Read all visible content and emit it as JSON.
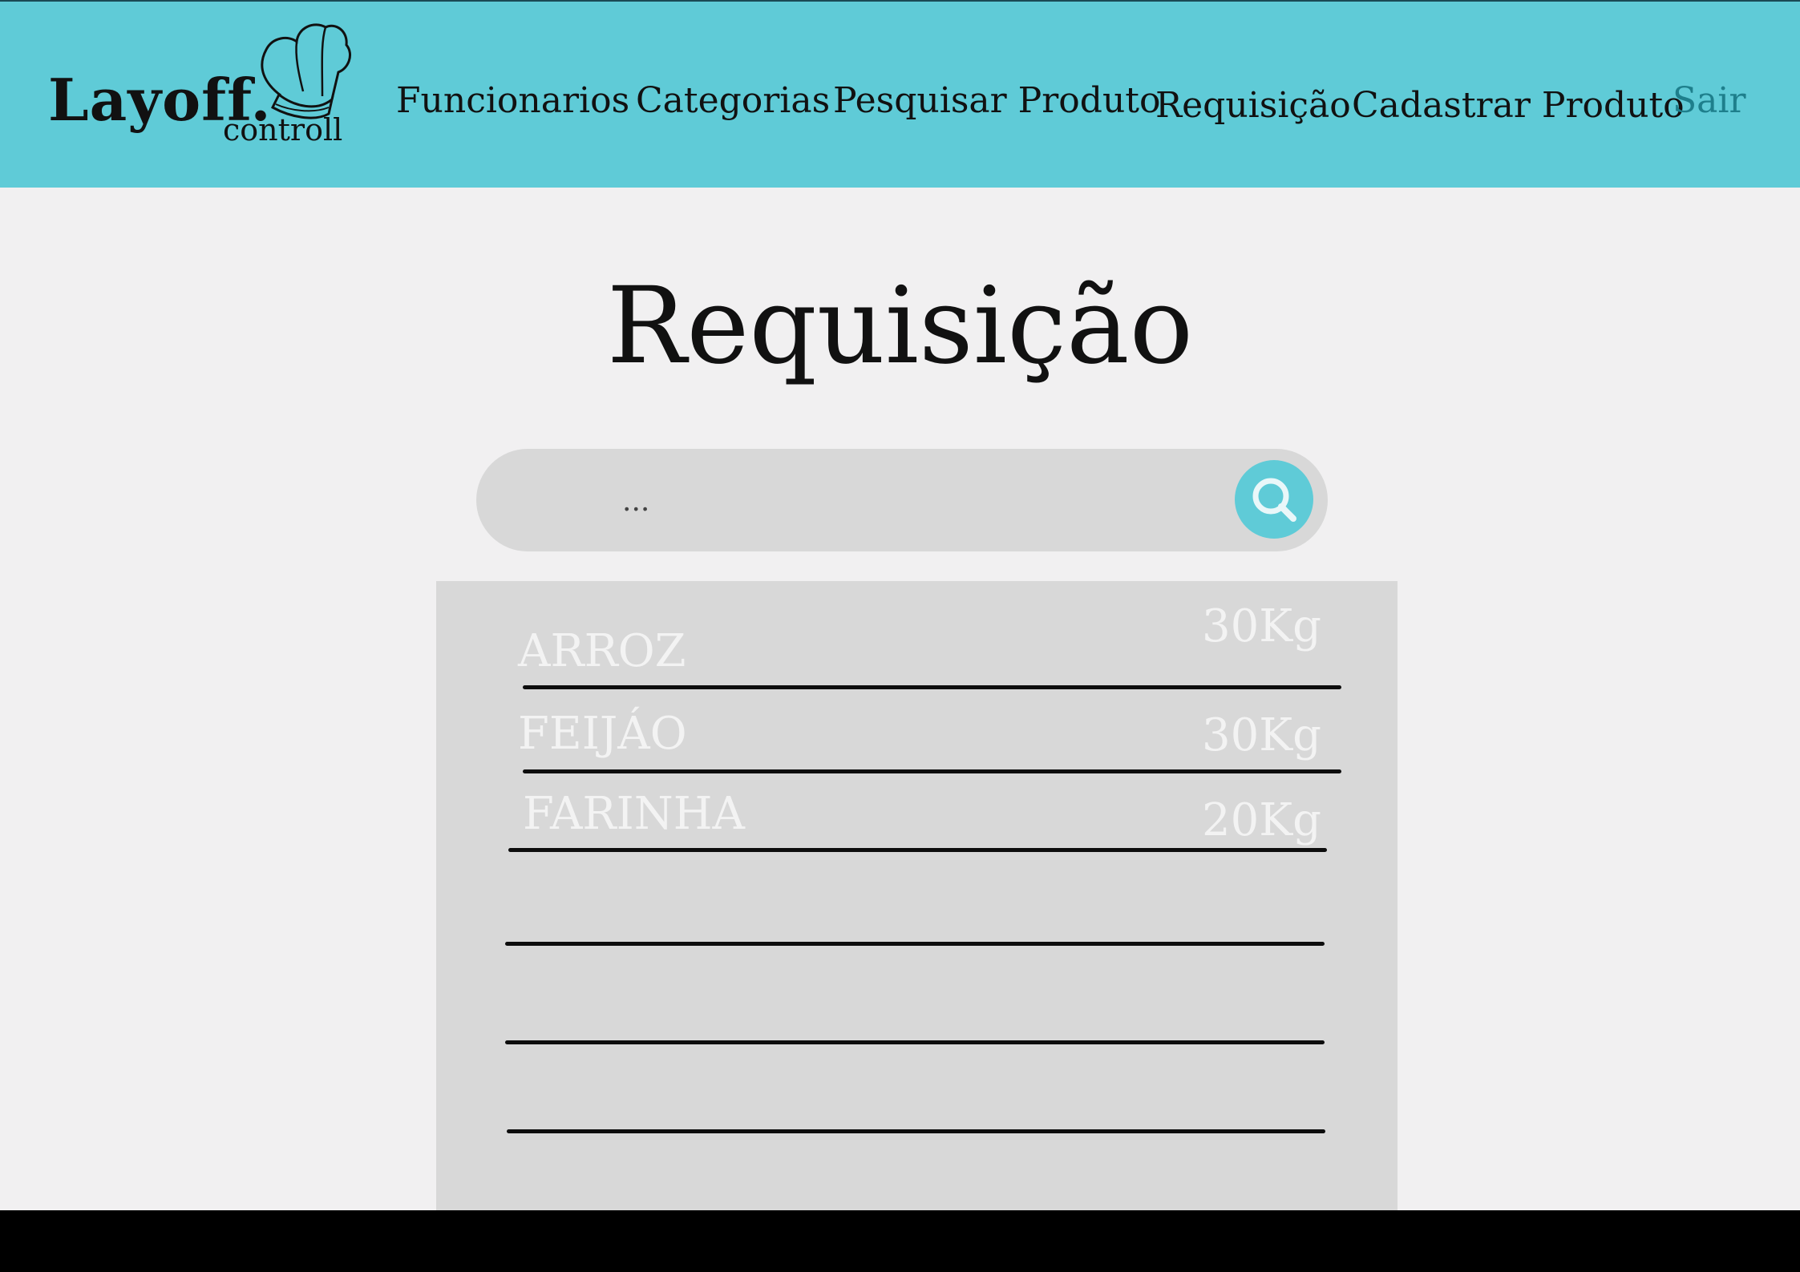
{
  "brand": {
    "name": "Layoff.",
    "sub": "controll"
  },
  "nav": {
    "items": [
      {
        "label": "Funcionarios"
      },
      {
        "label": "Categorias"
      },
      {
        "label": "Pesquisar Produto"
      },
      {
        "label": "Requisição"
      },
      {
        "label": "Cadastrar Produto"
      },
      {
        "label": "Sair"
      }
    ]
  },
  "page": {
    "title": "Requisição"
  },
  "search": {
    "placeholder": "...",
    "icon": "search-icon"
  },
  "list": {
    "items": [
      {
        "name": "ARROZ",
        "qty": "30Kg"
      },
      {
        "name": "FEIJÁO",
        "qty": "30Kg"
      },
      {
        "name": "FARINHA",
        "qty": "20Kg"
      }
    ]
  },
  "colors": {
    "header": "#5fcbd7",
    "accent": "#5fcbd7",
    "panel": "#d8d8d8",
    "footer": "#000000",
    "sair": "#1e7f8c"
  }
}
